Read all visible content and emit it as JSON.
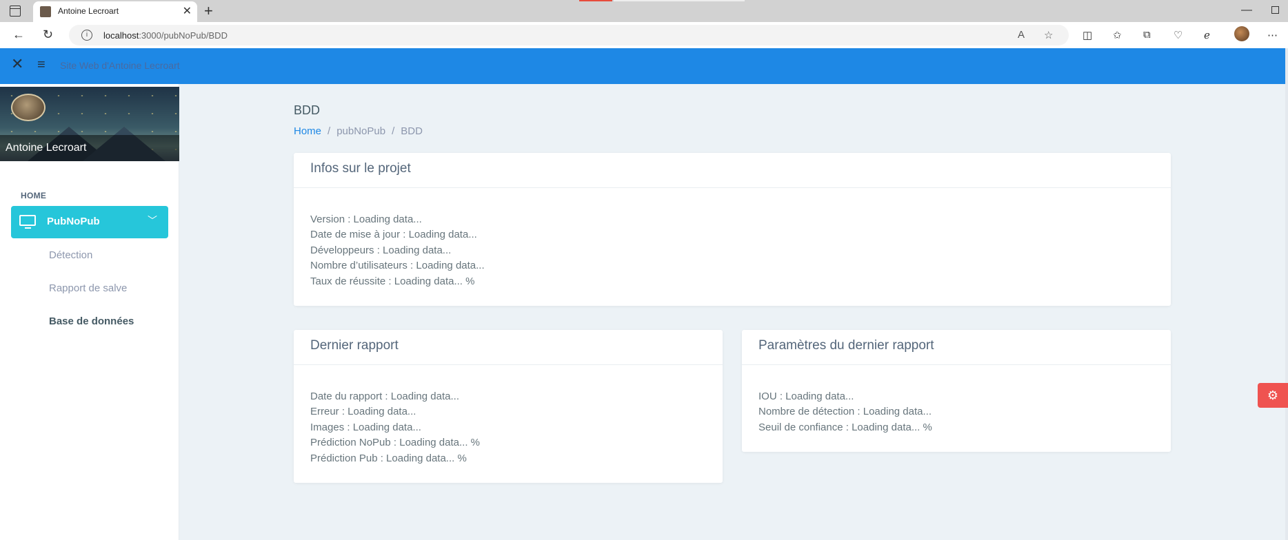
{
  "browser": {
    "tab_title": "Antoine Lecroart",
    "url_host": "localhost",
    "url_rest": ":3000/pubNoPub/BDD"
  },
  "topbar": {
    "brand": "Site Web d'Antoine Lecroart"
  },
  "sidebar": {
    "profile_name": "Antoine Lecroart",
    "section_caption": "HOME",
    "active_item": "PubNoPub",
    "sub_items": [
      "Détection",
      "Rapport de salve",
      "Base de données"
    ]
  },
  "page": {
    "title": "BDD",
    "breadcrumb": [
      "Home",
      "pubNoPub",
      "BDD"
    ]
  },
  "cards": {
    "project": {
      "title": "Infos sur le projet",
      "lines": [
        "Version : Loading data...",
        "Date de mise à jour : Loading data...",
        "Développeurs : Loading data...",
        "Nombre d’utilisateurs : Loading data...",
        "Taux de réussite : Loading data... %"
      ]
    },
    "last_report": {
      "title": "Dernier rapport",
      "lines": [
        "Date du rapport : Loading data...",
        "Erreur : Loading data...",
        "Images : Loading data...",
        "Prédiction NoPub : Loading data... %",
        "Prédiction Pub : Loading data... %"
      ]
    },
    "report_params": {
      "title": "Paramètres du dernier rapport",
      "lines": [
        "IOU : Loading data...",
        "Nombre de détection : Loading data...",
        "Seuil de confiance : Loading data... %"
      ]
    }
  },
  "icons": {
    "settings": "gear-icon"
  },
  "colors": {
    "topbar": "#1e88e5",
    "active_nav": "#26c6da",
    "settings_fab": "#ef5350",
    "link": "#1e88e5"
  }
}
